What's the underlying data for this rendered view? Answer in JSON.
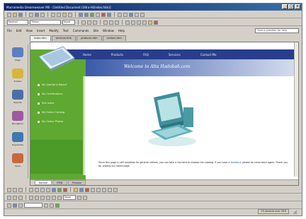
{
  "app": {
    "window_title": "Macromedia Dreamweaver MX - [Untitled Document (Ultra-Hi/index.htm)]"
  },
  "toolbars": {
    "style_value": "Normal",
    "font_value": "Times",
    "size_value": "None",
    "zoom_value": "None"
  },
  "menubar": {
    "items": [
      "File",
      "Edit",
      "View",
      "Insert",
      "Modify",
      "Text",
      "Commands",
      "Site",
      "Window",
      "Help"
    ]
  },
  "help_box": {
    "placeholder": "Type a question for help"
  },
  "doc_tabs": [
    "index.htm",
    "services.htm",
    "products.htm",
    "contact.htm"
  ],
  "left_panel": {
    "items": [
      {
        "label": "Page",
        "color": "#5b7fbf"
      },
      {
        "label": "Folders",
        "color": "#d9b53a"
      },
      {
        "label": "Reports",
        "color": "#4b6fa5"
      },
      {
        "label": "Navigation",
        "color": "#9c5aa0"
      },
      {
        "label": "Hyperlinks",
        "color": "#3d79b0"
      },
      {
        "label": "Tasks",
        "color": "#c9673f"
      }
    ]
  },
  "website": {
    "nav": [
      "Home",
      "Products",
      "FAQ",
      "Services",
      "Contact Me"
    ],
    "welcome": "Welcome to Alta Hadobah.com",
    "side_menu": [
      "My Quarterly Report",
      "My Certifications",
      "Site Index",
      "My Online Catalog",
      "My Online Photos"
    ],
    "body_text": "Since this page is still available for general visitors, you can take a moment to browse the catalog. If you have a",
    "body_link": "feedback",
    "body_text2": "please do come back again. Thank you for visiting our home page."
  },
  "bottom_doc_tabs": [
    "Normal",
    "HTML",
    "Preview"
  ],
  "status": {
    "right_text": "19 seconds over 28.8"
  },
  "colors": {
    "nav_blue": "#283e8c",
    "site_green": "#5fa832",
    "titlebar": "#0a246a"
  }
}
